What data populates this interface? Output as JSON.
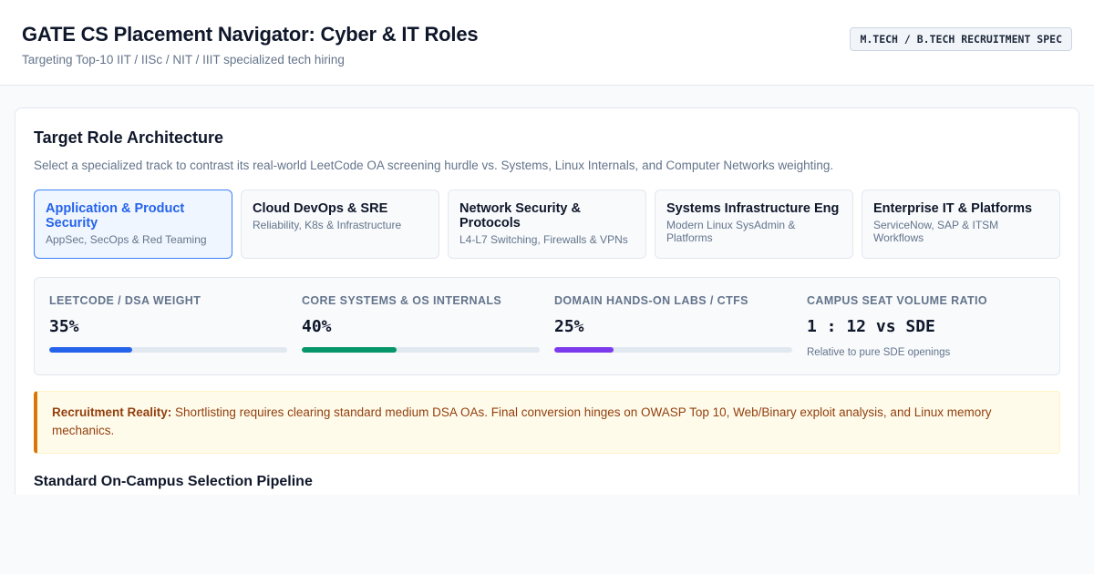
{
  "header": {
    "title": "GATE CS Placement Navigator: Cyber & IT Roles",
    "subtitle": "Targeting Top-10 IIT / IISc / NIT / IIIT specialized tech hiring",
    "badge": "M.TECH / B.TECH RECRUITMENT SPEC"
  },
  "section": {
    "title": "Target Role Architecture",
    "description": "Select a specialized track to contrast its real-world LeetCode OA screening hurdle vs. Systems, Linux Internals, and Computer Networks weighting."
  },
  "tracks": [
    {
      "title": "Application & Product Security",
      "subtitle": "AppSec, SecOps & Red Teaming",
      "active": true
    },
    {
      "title": "Cloud DevOps & SRE",
      "subtitle": "Reliability, K8s & Infrastructure",
      "active": false
    },
    {
      "title": "Network Security & Protocols",
      "subtitle": "L4-L7 Switching, Firewalls & VPNs",
      "active": false
    },
    {
      "title": "Systems Infrastructure Eng",
      "subtitle": "Modern Linux SysAdmin & Platforms",
      "active": false
    },
    {
      "title": "Enterprise IT & Platforms",
      "subtitle": "ServiceNow, SAP & ITSM Workflows",
      "active": false
    }
  ],
  "metrics": [
    {
      "label": "LeetCode / DSA Weight",
      "value": "35%",
      "fill": 0.35,
      "color": "#2563eb"
    },
    {
      "label": "Core Systems & OS Internals",
      "value": "40%",
      "fill": 0.4,
      "color": "#059669"
    },
    {
      "label": "Domain Hands-On Labs / CTFs",
      "value": "25%",
      "fill": 0.25,
      "color": "#7c3aed"
    },
    {
      "label": "Campus Seat Volume Ratio",
      "value": "1 : 12 vs SDE",
      "note": "Relative to pure SDE openings"
    }
  ],
  "alert": {
    "strong": "Recruitment Reality:",
    "text": " Shortlisting requires clearing standard medium DSA OAs. Final conversion hinges on OWASP Top 10, Web/Binary exploit analysis, and Linux memory mechanics."
  },
  "pipeline": {
    "title": "Standard On-Campus Selection Pipeline"
  }
}
